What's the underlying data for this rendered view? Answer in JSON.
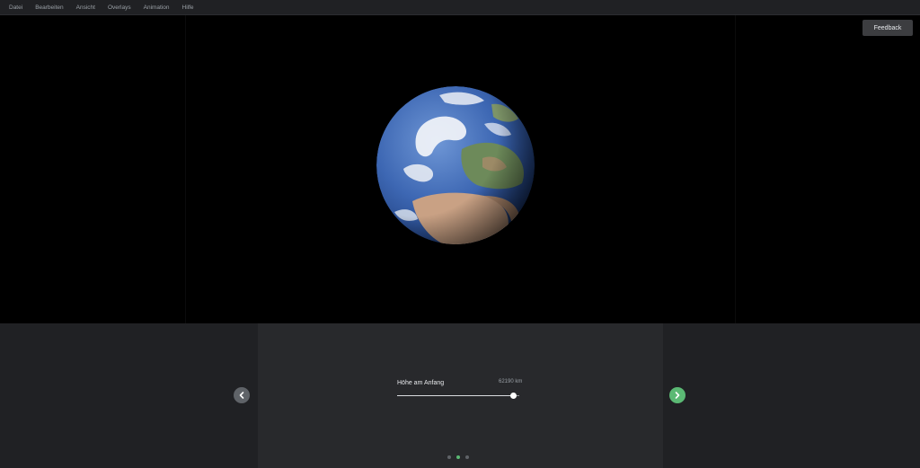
{
  "menu": {
    "items": [
      {
        "label": "Datei"
      },
      {
        "label": "Bearbeiten"
      },
      {
        "label": "Ansicht"
      },
      {
        "label": "Overlays"
      },
      {
        "label": "Animation"
      },
      {
        "label": "Hilfe"
      }
    ]
  },
  "feedback": {
    "label": "Feedback"
  },
  "viewer": {
    "globe_icon": "earth-globe"
  },
  "settings": {
    "label": "Höhe am Anfang",
    "value_text": "62190 km",
    "slider_fraction": 0.95
  },
  "navigation": {
    "prev_icon": "chevron-left-icon",
    "next_icon": "chevron-right-icon",
    "pages_total": 3,
    "active_page": 2
  },
  "colors": {
    "accent_green": "#5bb974",
    "panel_bg": "#202124",
    "card_bg": "#28292c"
  }
}
